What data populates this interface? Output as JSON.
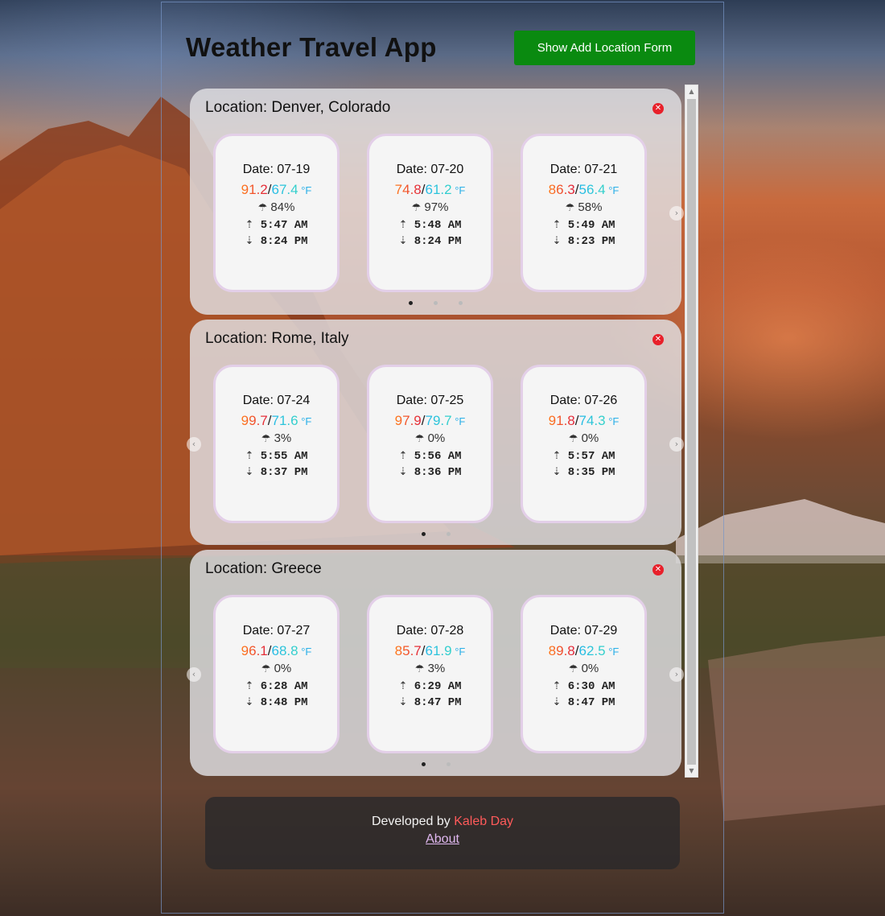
{
  "app": {
    "title": "Weather Travel App",
    "add_button_label": "Show Add Location Form"
  },
  "locations": [
    {
      "title": "Location: Denver, Colorado",
      "days": [
        {
          "date": "Date: 07-19",
          "high": "91.2",
          "low": "67.4",
          "unit": " °F",
          "rain": "84%",
          "sunrise": "5:47 AM",
          "sunset": "8:24 PM"
        },
        {
          "date": "Date: 07-20",
          "high": "74.8",
          "low": "61.2",
          "unit": " °F",
          "rain": "97%",
          "sunrise": "5:48 AM",
          "sunset": "8:24 PM"
        },
        {
          "date": "Date: 07-21",
          "high": "86.3",
          "low": "56.4",
          "unit": " °F",
          "rain": "58%",
          "sunrise": "5:49 AM",
          "sunset": "8:23 PM"
        }
      ]
    },
    {
      "title": "Location: Rome, Italy",
      "days": [
        {
          "date": "Date: 07-24",
          "high": "99.7",
          "low": "71.6",
          "unit": " °F",
          "rain": "3%",
          "sunrise": "5:55 AM",
          "sunset": "8:37 PM"
        },
        {
          "date": "Date: 07-25",
          "high": "97.9",
          "low": "79.7",
          "unit": " °F",
          "rain": "0%",
          "sunrise": "5:56 AM",
          "sunset": "8:36 PM"
        },
        {
          "date": "Date: 07-26",
          "high": "91.8",
          "low": "74.3",
          "unit": " °F",
          "rain": "0%",
          "sunrise": "5:57 AM",
          "sunset": "8:35 PM"
        }
      ]
    },
    {
      "title": "Location: Greece",
      "days": [
        {
          "date": "Date: 07-27",
          "high": "96.1",
          "low": "68.8",
          "unit": " °F",
          "rain": "0%",
          "sunrise": "6:28 AM",
          "sunset": "8:48 PM"
        },
        {
          "date": "Date: 07-28",
          "high": "85.7",
          "low": "61.9",
          "unit": " °F",
          "rain": "3%",
          "sunrise": "6:29 AM",
          "sunset": "8:47 PM"
        },
        {
          "date": "Date: 07-29",
          "high": "89.8",
          "low": "62.5",
          "unit": " °F",
          "rain": "0%",
          "sunrise": "6:30 AM",
          "sunset": "8:47 PM"
        }
      ]
    }
  ],
  "footer": {
    "developed_by": "Developed by ",
    "developer_name": "Kaleb Day",
    "about_link": "About"
  },
  "colors": {
    "add_button": "#0a8a10",
    "remove_button": "#e8202a",
    "temp_high": "#e0203c",
    "temp_low": "#22b8e8",
    "developer_name": "#ff5a5a",
    "about_link": "#e0b8f0"
  },
  "icons": {
    "remove": "close-circle-icon",
    "rain": "rain-cloud-icon",
    "sunrise": "sunrise-icon",
    "sunset": "sunset-icon",
    "carousel_prev": "chevron-left-icon",
    "carousel_next": "chevron-right-icon"
  }
}
